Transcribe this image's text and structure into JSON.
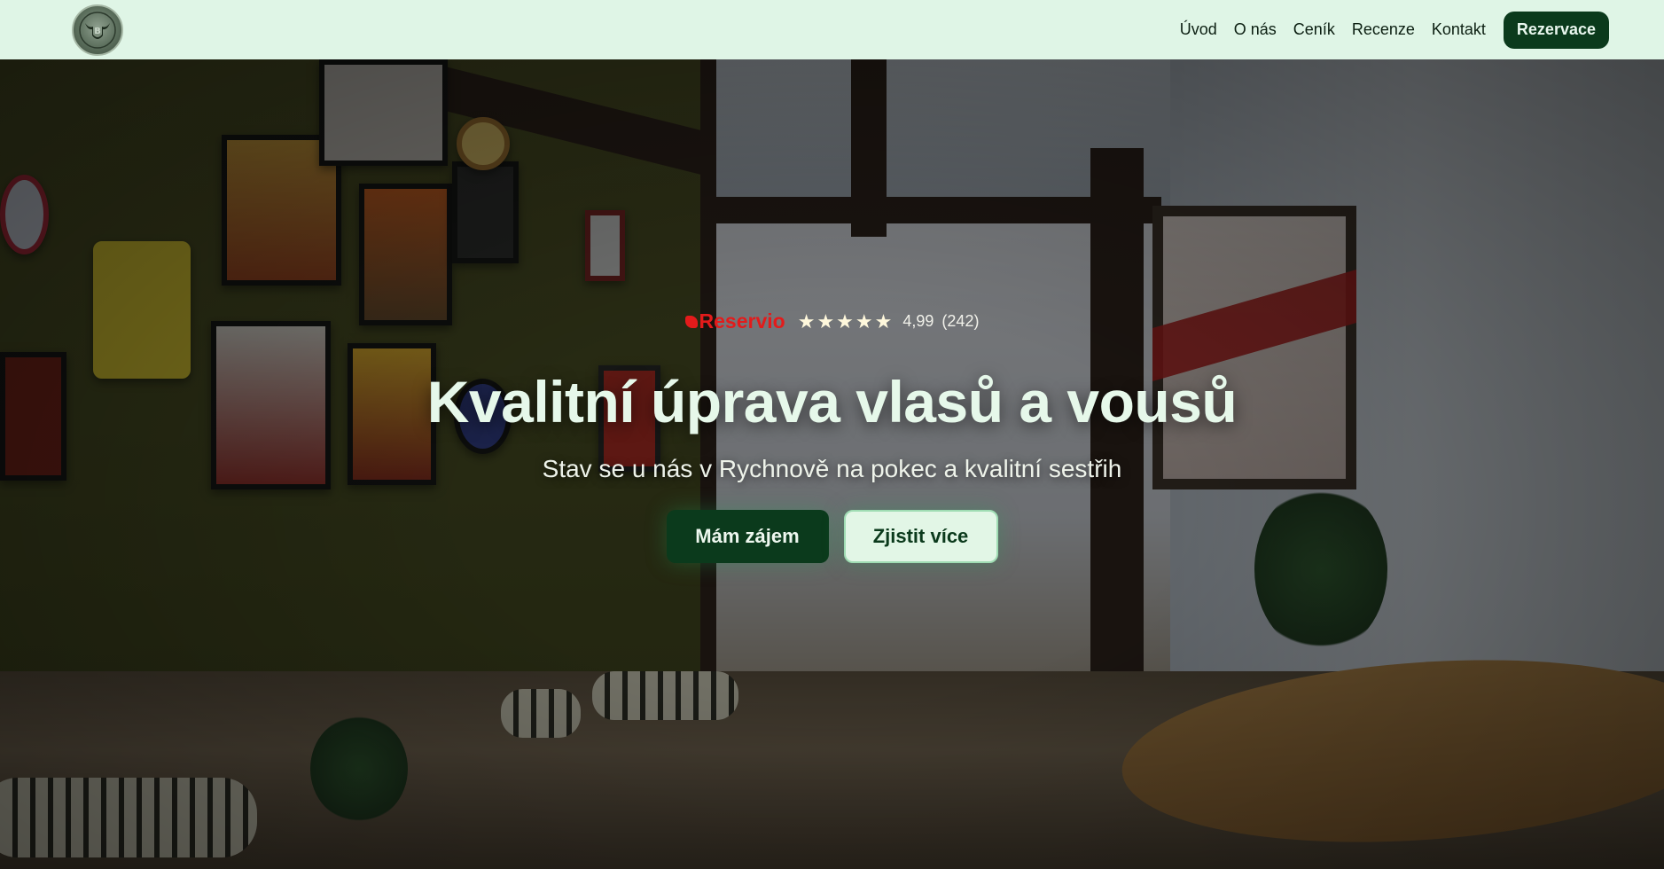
{
  "brand": {
    "logo_icon": "bull-head-logo-icon"
  },
  "nav": {
    "links": [
      "Úvod",
      "O nás",
      "Ceník",
      "Recenze",
      "Kontakt"
    ],
    "cta": "Rezervace"
  },
  "hero": {
    "reservio_label": "Reservio",
    "stars": 5,
    "rating": "4,99",
    "reviews": "(242)",
    "title": "Kvalitní úprava vlasů a vousů",
    "subtitle": "Stav se u nás v Rychnově na pokec a kvalitní sestřih",
    "primary_button": "Mám zájem",
    "secondary_button": "Zjistit více"
  },
  "colors": {
    "header_bg": "#dff5e6",
    "brand_dark_green": "#0b3a1c",
    "title_color": "#e6f8ea",
    "reservio_red": "#e31b1b"
  }
}
